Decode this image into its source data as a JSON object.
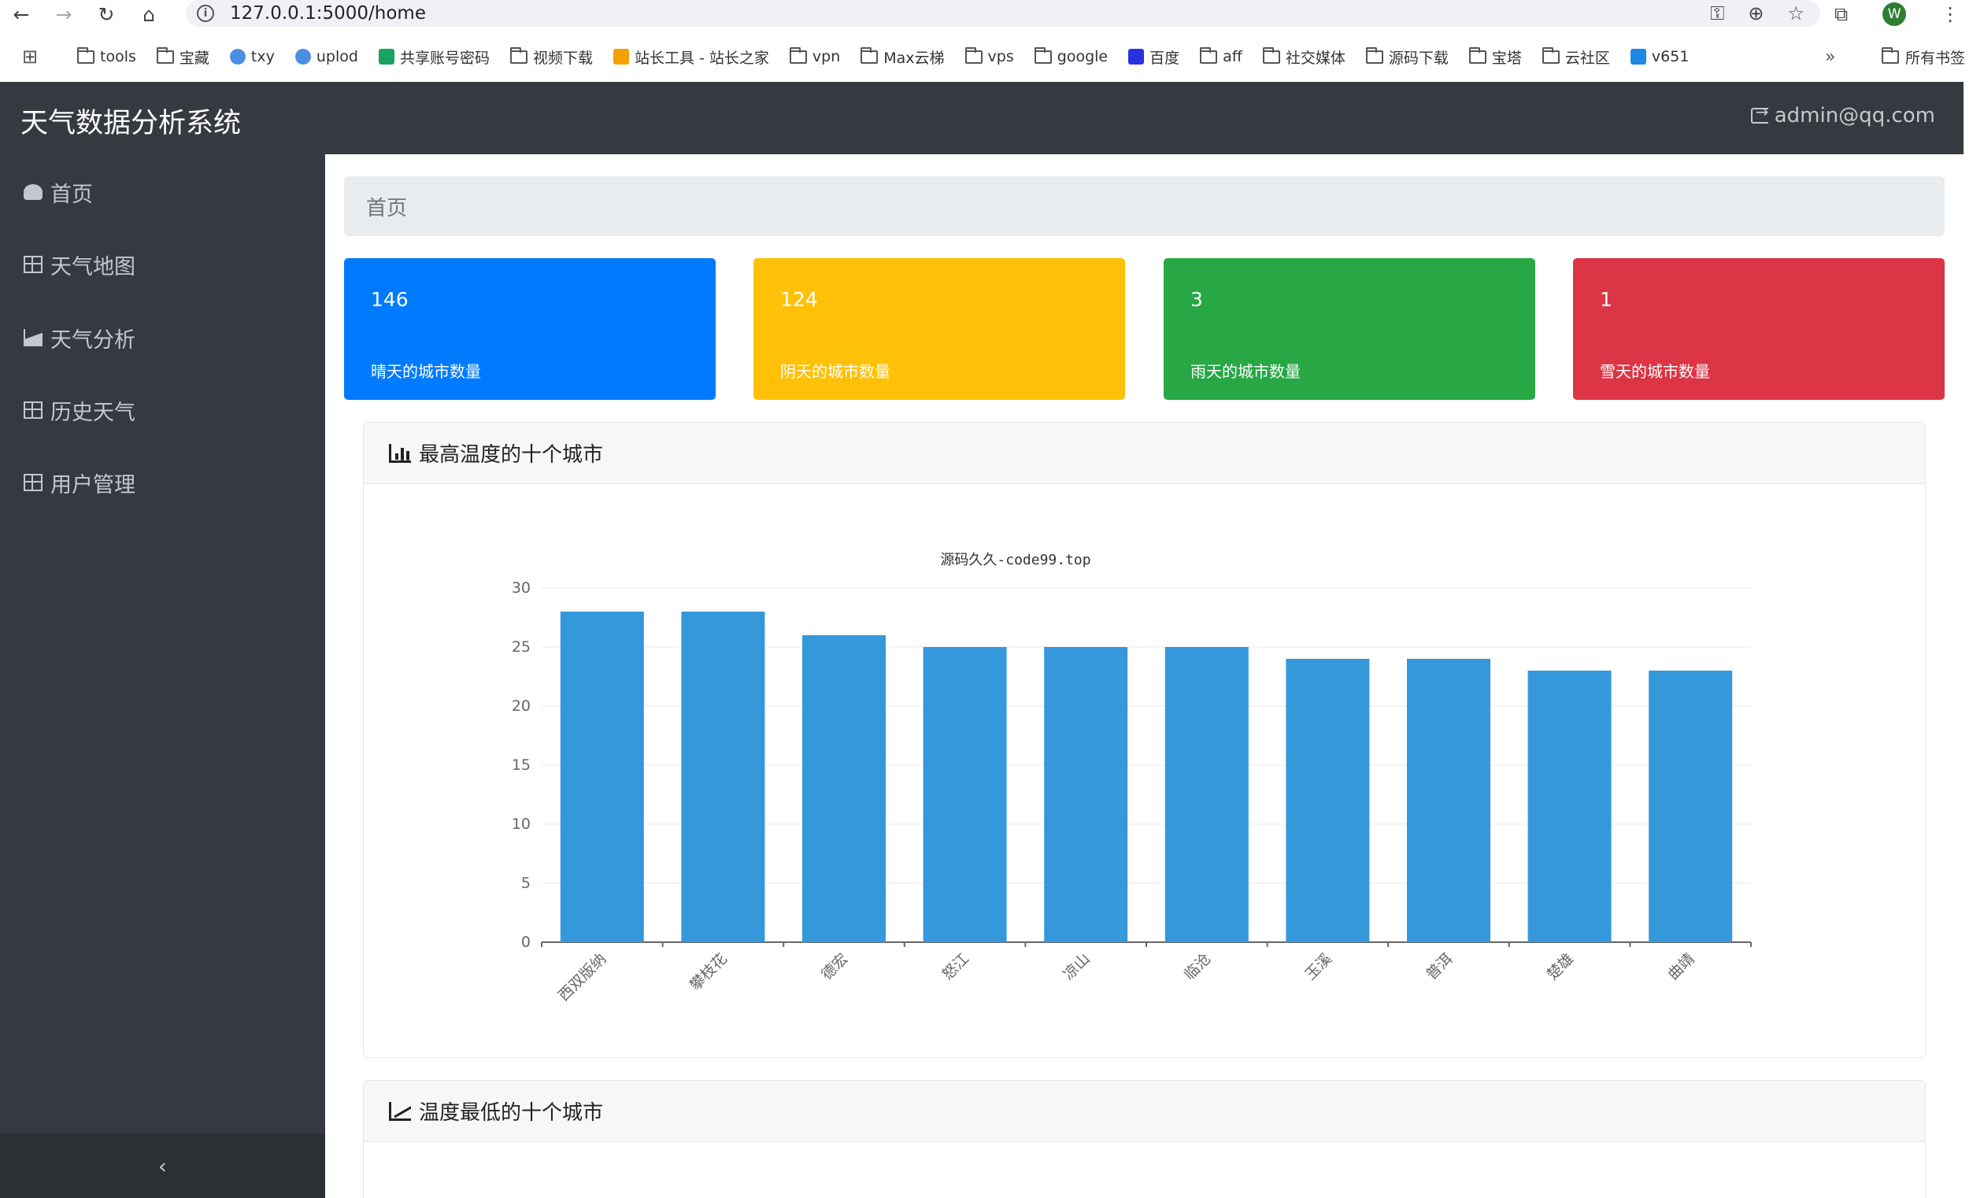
{
  "browser": {
    "url": "127.0.0.1:5000/home",
    "profile_initial": "W",
    "bookmarks": [
      {
        "label": "tools",
        "icon": "folder"
      },
      {
        "label": "宝藏",
        "icon": "folder"
      },
      {
        "label": "txy",
        "icon": "cloud"
      },
      {
        "label": "uplod",
        "icon": "cloud"
      },
      {
        "label": "共享账号密码",
        "icon": "sheet"
      },
      {
        "label": "视频下载",
        "icon": "folder"
      },
      {
        "label": "站长工具 - 站长之家",
        "icon": "site"
      },
      {
        "label": "vpn",
        "icon": "folder"
      },
      {
        "label": "Max云梯",
        "icon": "folder"
      },
      {
        "label": "vps",
        "icon": "folder"
      },
      {
        "label": "google",
        "icon": "folder"
      },
      {
        "label": "百度",
        "icon": "baidu"
      },
      {
        "label": "aff",
        "icon": "folder"
      },
      {
        "label": "社交媒体",
        "icon": "folder"
      },
      {
        "label": "源码下载",
        "icon": "folder"
      },
      {
        "label": "宝塔",
        "icon": "folder"
      },
      {
        "label": "云社区",
        "icon": "folder"
      },
      {
        "label": "v651",
        "icon": "v"
      }
    ],
    "more_label": "»",
    "all_bookmarks": "所有书签"
  },
  "navbar": {
    "brand": "天气数据分析系统",
    "user": "admin@qq.com"
  },
  "sidebar": {
    "items": [
      {
        "label": "首页",
        "icon": "dashboard"
      },
      {
        "label": "天气地图",
        "icon": "table"
      },
      {
        "label": "天气分析",
        "icon": "area-chart"
      },
      {
        "label": "历史天气",
        "icon": "table"
      },
      {
        "label": "用户管理",
        "icon": "table"
      }
    ],
    "collapse": "‹"
  },
  "breadcrumb": "首页",
  "stats": [
    {
      "value": "146",
      "label": "晴天的城市数量",
      "color": "#007bff"
    },
    {
      "value": "124",
      "label": "阴天的城市数量",
      "color": "#ffc107"
    },
    {
      "value": "3",
      "label": "雨天的城市数量",
      "color": "#28a745"
    },
    {
      "value": "1",
      "label": "雪天的城市数量",
      "color": "#dc3545"
    }
  ],
  "cards": {
    "max_temp_title": "最高温度的十个城市",
    "min_temp_title": "温度最低的十个城市"
  },
  "chart_data": {
    "type": "bar",
    "title": "源码久久-code99.top",
    "categories": [
      "西双版纳",
      "攀枝花",
      "德宏",
      "怒江",
      "凉山",
      "临沧",
      "玉溪",
      "普洱",
      "楚雄",
      "曲靖"
    ],
    "values": [
      28,
      28,
      26,
      25,
      25,
      25,
      24,
      24,
      23,
      23
    ],
    "ylim": [
      0,
      30
    ],
    "yticks": [
      0,
      5,
      10,
      15,
      20,
      25,
      30
    ],
    "bar_color": "#3498db",
    "grid": true
  }
}
